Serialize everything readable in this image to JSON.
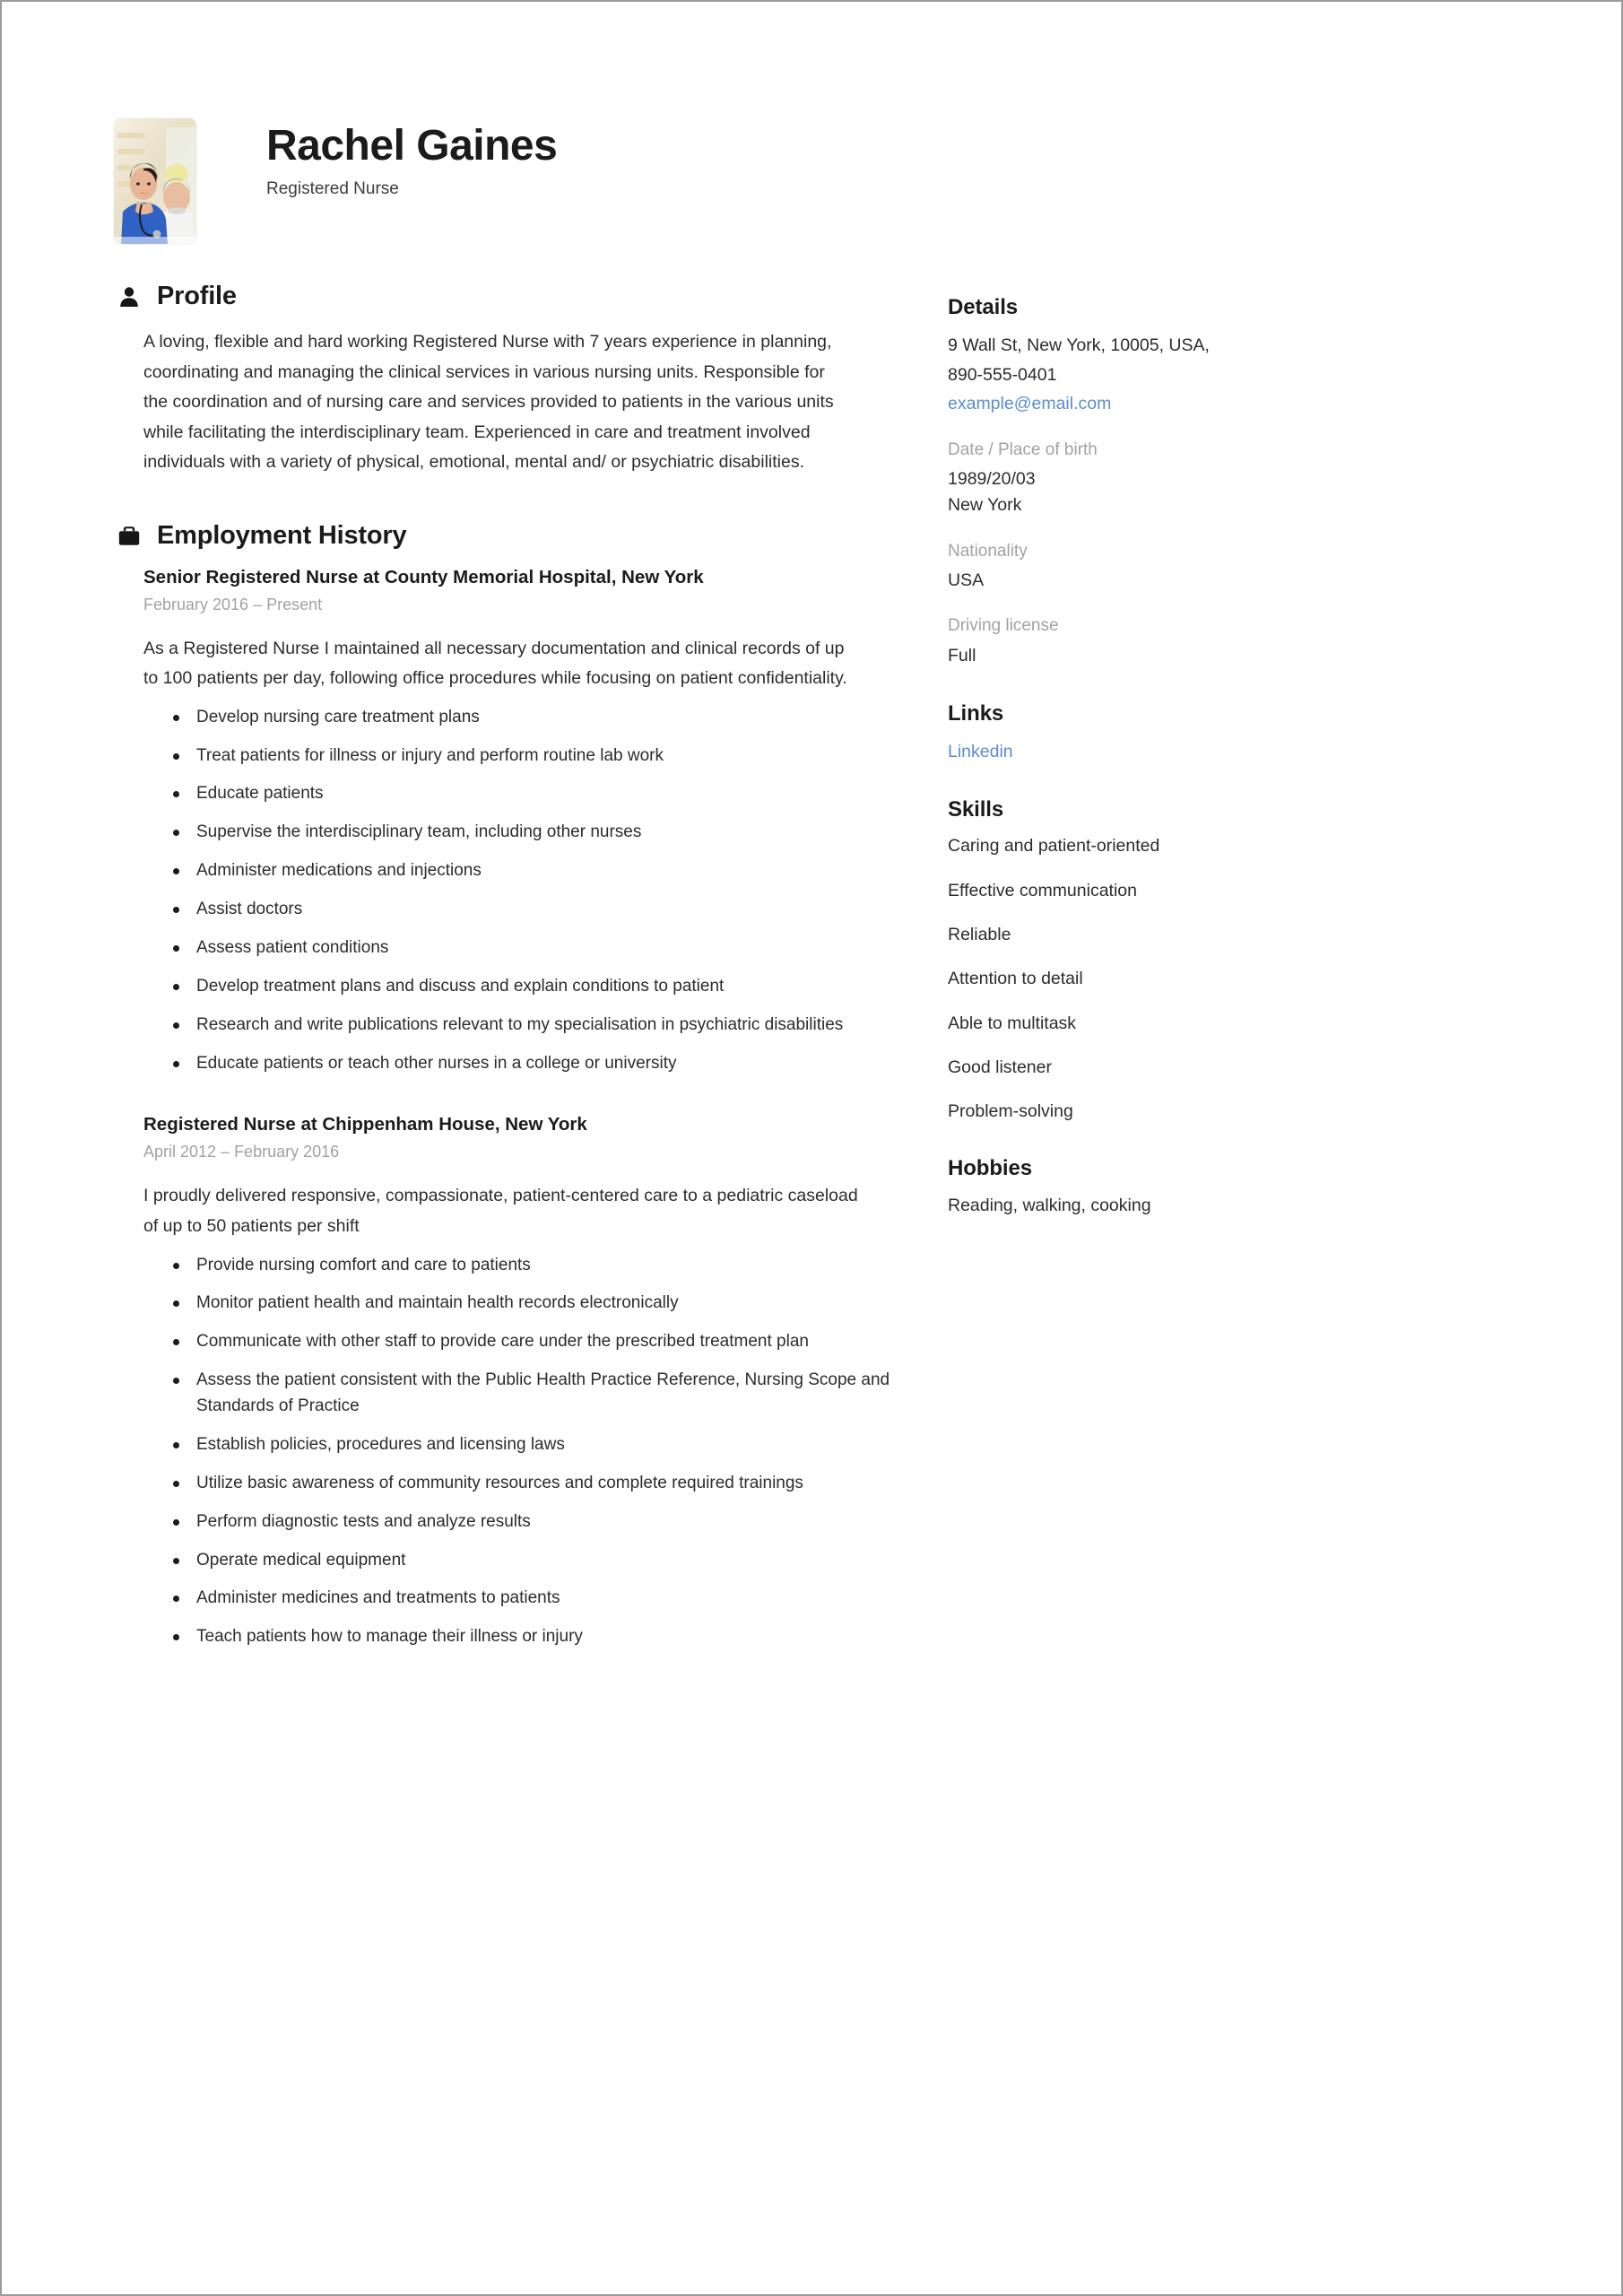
{
  "header": {
    "name": "Rachel Gaines",
    "job_title": "Registered Nurse",
    "avatar_alt": "nurse-photo"
  },
  "profile": {
    "icon": "person-icon",
    "title": "Profile",
    "text": "A loving, flexible and hard working Registered Nurse with 7 years experience in planning, coordinating and managing the clinical services in various nursing units. Responsible for the coordination and of nursing care and services provided to patients in the various units while facilitating the interdisciplinary team. Experienced in care and treatment involved individuals with a variety of physical, emotional, mental and/ or psychiatric disabilities."
  },
  "employment": {
    "icon": "briefcase-icon",
    "title": "Employment History",
    "jobs": [
      {
        "heading": "Senior Registered Nurse at County Memorial Hospital, New York",
        "dates": "February 2016  –  Present",
        "description": "As a Registered Nurse I maintained all necessary documentation and clinical records of up to 100 patients per day, following office procedures while focusing on patient confidentiality.",
        "bullets": [
          "Develop nursing care treatment plans",
          "Treat patients for illness or injury and perform routine lab work",
          "Educate patients",
          "Supervise the interdisciplinary team, including other nurses",
          "Administer medications and injections",
          "Assist doctors",
          "Assess patient conditions",
          "Develop treatment plans and discuss and explain conditions to patient",
          "Research and write publications relevant to my specialisation in psychiatric disabilities",
          "Educate patients or teach other nurses in a college or university"
        ]
      },
      {
        "heading": "Registered Nurse at Chippenham House, New York",
        "dates": "April 2012  –  February 2016",
        "description": "I proudly delivered responsive, compassionate, patient-centered care to a pediatric caseload of up to 50 patients per shift",
        "bullets": [
          "Provide nursing comfort and care to patients",
          "Monitor patient health and maintain health records electronically",
          "Communicate with other staff to provide care under the prescribed treatment plan",
          "Assess the patient consistent with the Public Health Practice Reference, Nursing Scope and Standards of Practice",
          "Establish policies, procedures and licensing laws",
          "Utilize basic awareness of community resources and complete required trainings",
          "Perform diagnostic tests and analyze results",
          "Operate medical equipment",
          "Administer medicines and treatments to patients",
          "Teach patients how to manage their illness or injury"
        ]
      }
    ]
  },
  "sidebar": {
    "details": {
      "title": "Details",
      "address": "9 Wall St, New York, 10005, USA,",
      "phone": "890-555-0401",
      "email": "example@email.com",
      "dob_label": "Date / Place of birth",
      "dob_value": "1989/20/03",
      "birth_place": "New York",
      "nationality_label": "Nationality",
      "nationality_value": "USA",
      "license_label": "Driving license",
      "license_value": "Full"
    },
    "links": {
      "title": "Links",
      "items": [
        {
          "label": "Linkedin"
        }
      ]
    },
    "skills": {
      "title": "Skills",
      "items": [
        "Caring and patient-oriented",
        "Effective communication",
        "Reliable",
        "Attention to detail",
        "Able to multitask",
        "Good listener",
        "Problem-solving"
      ]
    },
    "hobbies": {
      "title": "Hobbies",
      "text": "Reading, walking, cooking"
    }
  },
  "colors": {
    "link": "#5b8ec9",
    "muted": "#a2a2a2",
    "text": "#2c2c2c",
    "heading": "#1b1b1b"
  }
}
